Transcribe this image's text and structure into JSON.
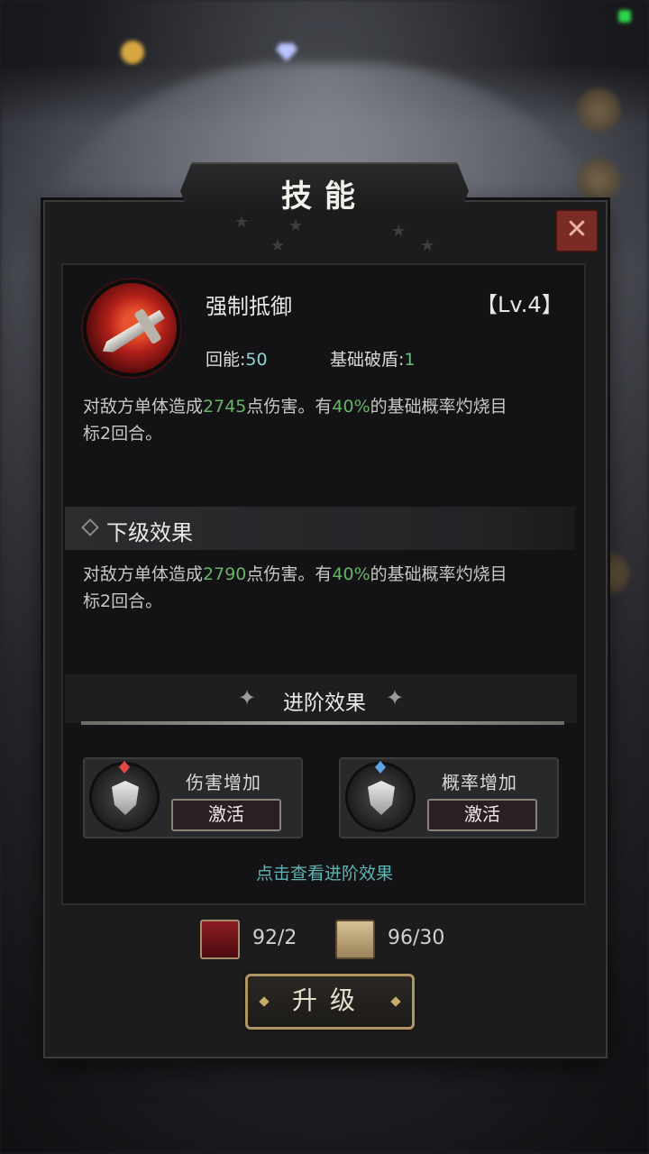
{
  "panel": {
    "title": "技能"
  },
  "skill": {
    "name": "强制抵御",
    "level": "【Lv.4】",
    "energy_label": "回能:",
    "energy_value": "50",
    "break_label": "基础破盾:",
    "break_value": "1",
    "desc_a": "对敌方单体造成",
    "desc_dmg": "2745",
    "desc_b": "点伤害。有",
    "desc_pct": "40%",
    "desc_c": "的基础概率灼烧目",
    "desc_d": "标2回合。"
  },
  "next_level": {
    "title": "下级效果",
    "desc_a": "对敌方单体造成",
    "desc_dmg": "2790",
    "desc_b": "点伤害。有",
    "desc_pct": "40%",
    "desc_c": "的基础概率灼烧目",
    "desc_d": "标2回合。"
  },
  "advanced": {
    "title": "进阶效果",
    "cards": [
      {
        "label": "伤害增加",
        "button": "激活",
        "gem_color": "#e04848"
      },
      {
        "label": "概率增加",
        "button": "激活",
        "gem_color": "#5aa6e6"
      }
    ],
    "link": "点击查看进阶效果"
  },
  "costs": [
    {
      "icon": "red-book-icon",
      "value": "92/2"
    },
    {
      "icon": "scroll-icon",
      "value": "96/30"
    }
  ],
  "upgrade_button": "升级",
  "colors": {
    "accent_green": "#67b466",
    "accent_cyan": "#8fd3d6",
    "link_teal": "#5fb5b3",
    "close_red": "#7a2b25"
  }
}
